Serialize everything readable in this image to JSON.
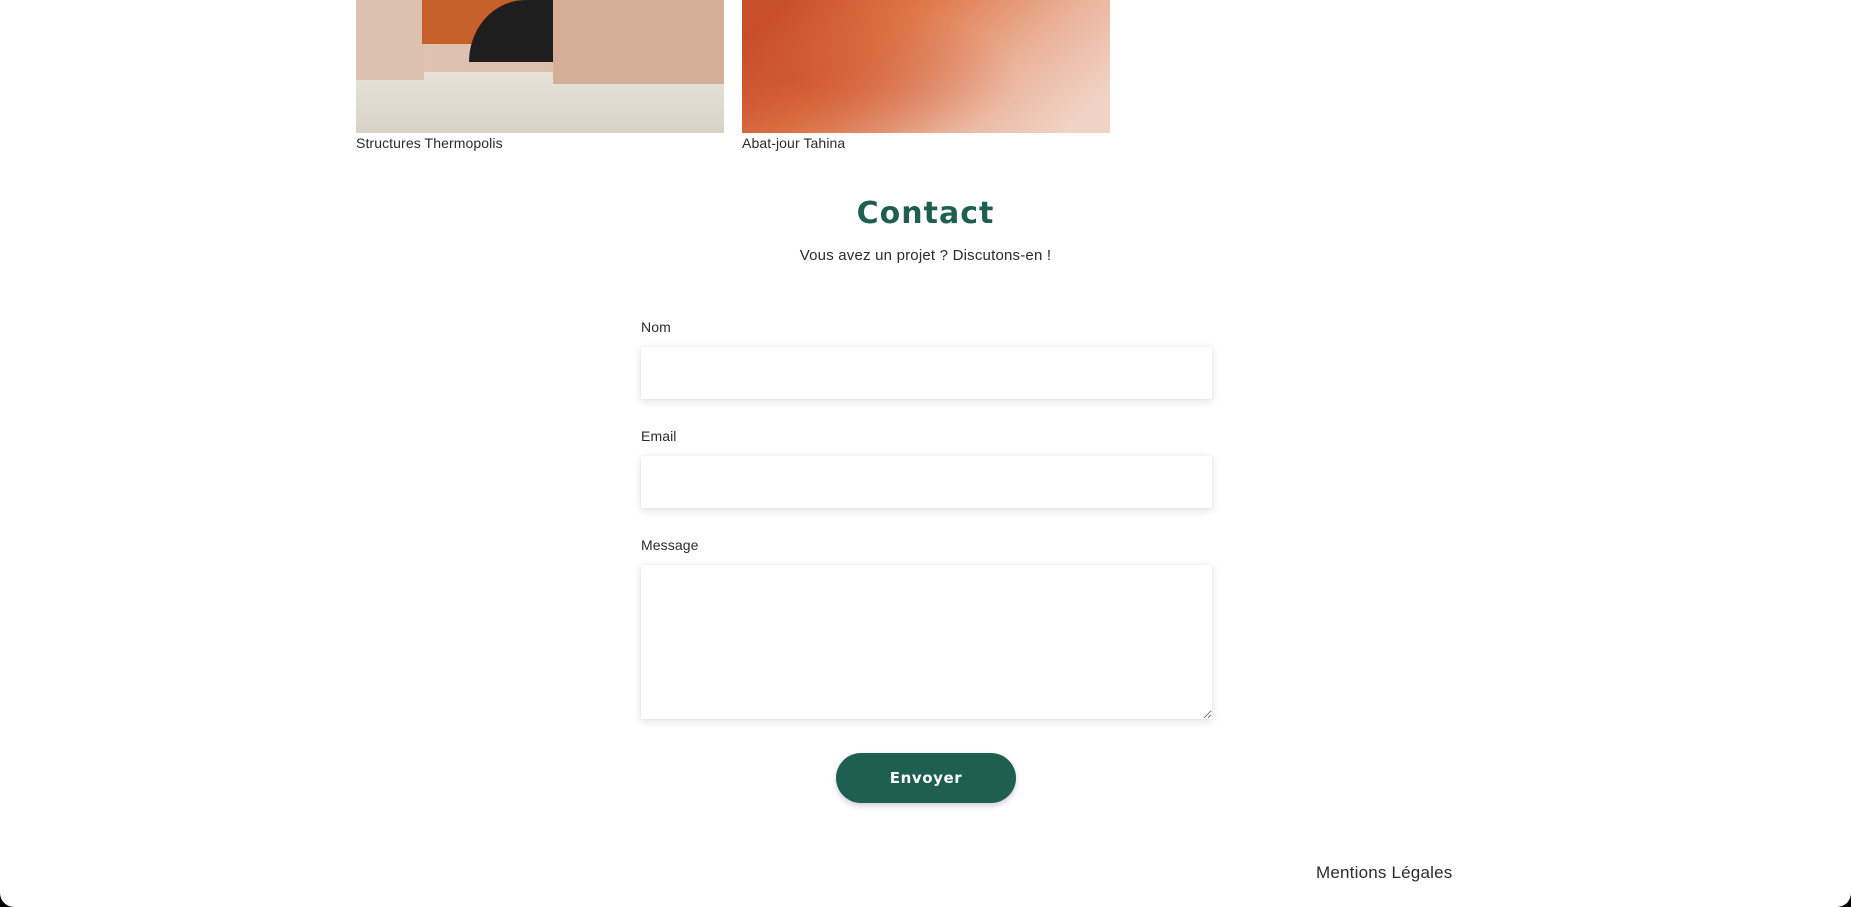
{
  "projects": [
    {
      "caption": "Structures Thermopolis"
    },
    {
      "caption": "Abat-jour Tahina"
    }
  ],
  "contact": {
    "title": "Contact",
    "subtitle": "Vous avez un projet ? Discutons-en !"
  },
  "form": {
    "name_label": "Nom",
    "name_value": "",
    "email_label": "Email",
    "email_value": "",
    "message_label": "Message",
    "message_value": "",
    "submit_label": "Envoyer"
  },
  "footer": {
    "legal_link": "Mentions Légales"
  },
  "colors": {
    "accent": "#1f5f52",
    "text": "#2b2b2b",
    "background": "#ffffff"
  }
}
